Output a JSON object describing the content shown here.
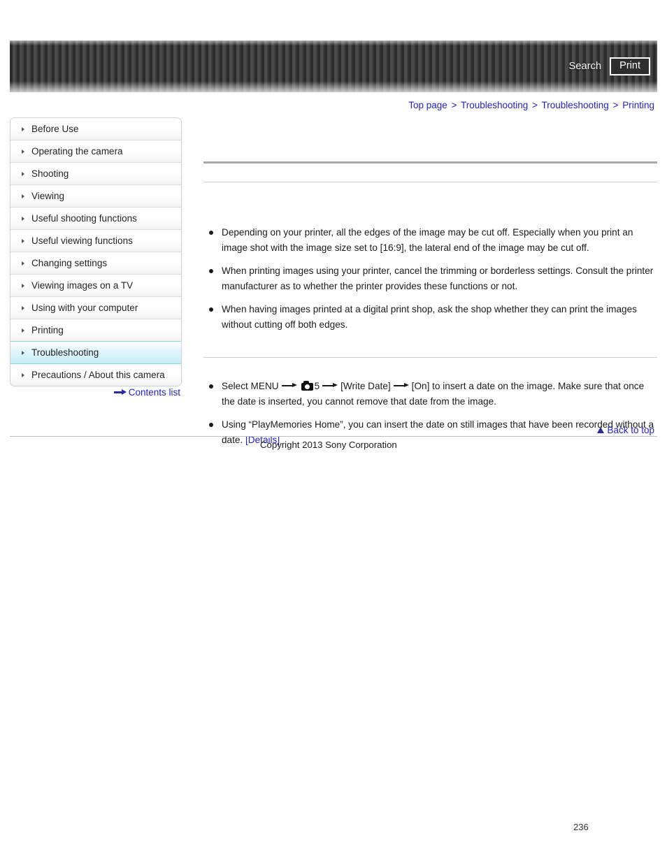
{
  "header": {
    "search_label": "Search",
    "print_label": "Print",
    "search_icon": "search-icon",
    "print_icon": "printer-icon"
  },
  "breadcrumb": {
    "separator": ">",
    "items": [
      {
        "label": "Top page"
      },
      {
        "label": "Troubleshooting"
      },
      {
        "label": "Troubleshooting"
      },
      {
        "label": "Printing"
      }
    ]
  },
  "sidebar": {
    "items": [
      {
        "label": "Before Use",
        "active": false
      },
      {
        "label": "Operating the camera",
        "active": false
      },
      {
        "label": "Shooting",
        "active": false
      },
      {
        "label": "Viewing",
        "active": false
      },
      {
        "label": "Useful shooting functions",
        "active": false
      },
      {
        "label": "Useful viewing functions",
        "active": false
      },
      {
        "label": "Changing settings",
        "active": false
      },
      {
        "label": "Viewing images on a TV",
        "active": false
      },
      {
        "label": "Using with your computer",
        "active": false
      },
      {
        "label": "Printing",
        "active": false
      },
      {
        "label": "Troubleshooting",
        "active": true
      },
      {
        "label": "Precautions / About this camera",
        "active": false
      }
    ],
    "contents_list_label": "Contents list",
    "contents_list_icon": "arrow-right-icon",
    "bullet_icon": "triangle-right-icon"
  },
  "main": {
    "section_title": "",
    "section1": {
      "bullets": [
        "Depending on your printer, all the edges of the image may be cut off. Especially when you print an image shot with the image size set to [16:9], the lateral end of the image may be cut off.",
        "When printing images using your printer, cancel the trimming or borderless settings. Consult the printer manufacturer as to whether the printer provides these functions or not.",
        "When having images printed at a digital print shop, ask the shop whether they can print the images without cutting off both edges."
      ]
    },
    "section2": {
      "bullet1": {
        "part1": "Select MENU",
        "camera_icon": "camera-mode-icon",
        "menu_number": "5",
        "part2": "[Write Date]",
        "part3": "[On] to insert a date on the image. Make sure that once the date is inserted, you cannot remove that date from the image."
      },
      "bullet2": {
        "text": "Using “PlayMemories Home”, you can insert the date on still images that have been recorded without a date.",
        "link_label": "[Details]"
      }
    }
  },
  "footer": {
    "back_to_top_label": "Back to top",
    "back_to_top_icon": "triangle-up-icon",
    "copyright": "Copyright 2013 Sony Corporation",
    "page_number": "236"
  },
  "colors": {
    "link": "#2222cc",
    "accent_highlight": "#c9eef7",
    "header_dark": "#2b2b2b",
    "rule_strong": "#a8a8a8",
    "rule_light": "#cfcfcf"
  }
}
